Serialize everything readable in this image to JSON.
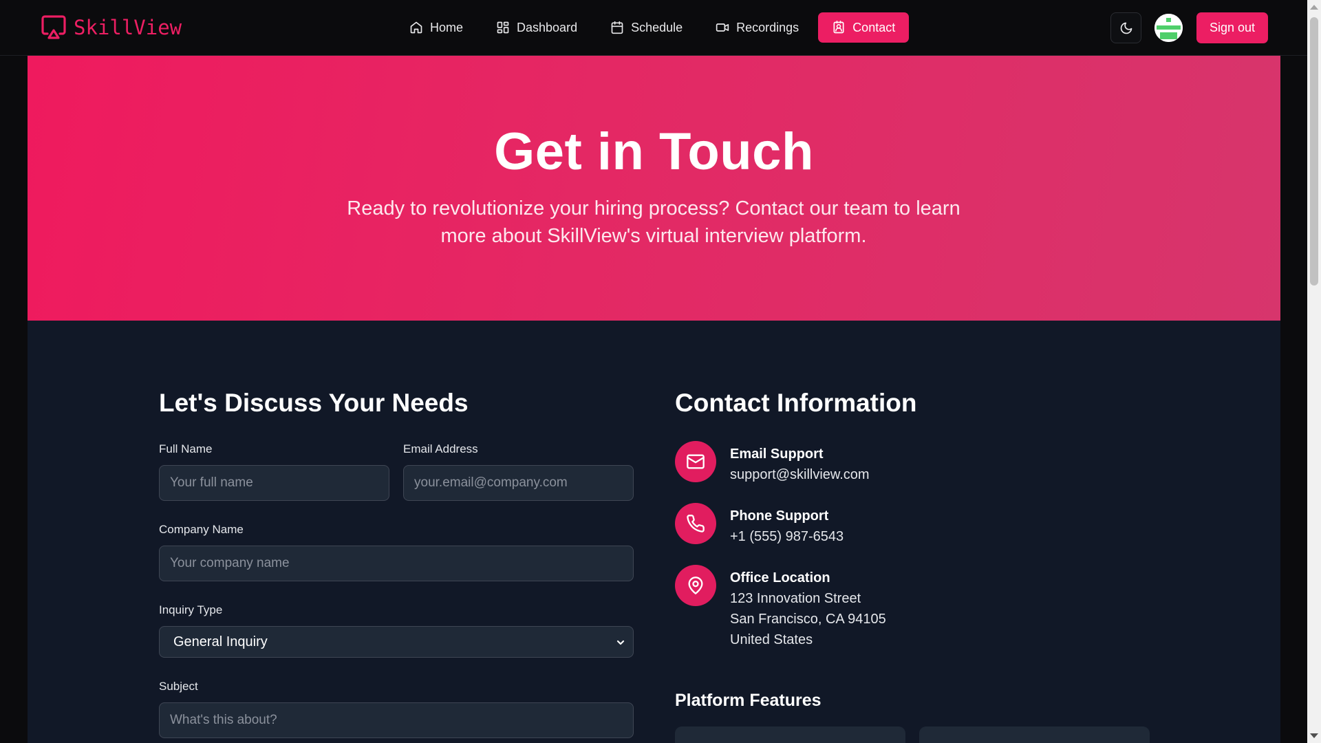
{
  "brand": {
    "name": "SkillView",
    "accent": "#ec1e63"
  },
  "nav": {
    "links": [
      {
        "label": "Home",
        "icon": "home-icon"
      },
      {
        "label": "Dashboard",
        "icon": "dashboard-icon"
      },
      {
        "label": "Schedule",
        "icon": "calendar-icon"
      },
      {
        "label": "Recordings",
        "icon": "video-icon"
      },
      {
        "label": "Contact",
        "icon": "contact-icon",
        "active": true
      }
    ],
    "theme_toggle_icon": "moon-icon",
    "signout_label": "Sign out"
  },
  "hero": {
    "title": "Get in Touch",
    "subtitle": "Ready to revolutionize your hiring process? Contact our team to learn more about SkillView's virtual interview platform."
  },
  "form": {
    "title": "Let's Discuss Your Needs",
    "full_name": {
      "label": "Full Name",
      "placeholder": "Your full name",
      "value": ""
    },
    "email": {
      "label": "Email Address",
      "placeholder": "your.email@company.com",
      "value": ""
    },
    "company": {
      "label": "Company Name",
      "placeholder": "Your company name",
      "value": ""
    },
    "inquiry": {
      "label": "Inquiry Type",
      "selected": "General Inquiry"
    },
    "subject": {
      "label": "Subject",
      "placeholder": "What's this about?",
      "value": ""
    }
  },
  "contact_info": {
    "title": "Contact Information",
    "email": {
      "heading": "Email Support",
      "value": "support@skillview.com",
      "icon": "mail-icon"
    },
    "phone": {
      "heading": "Phone Support",
      "value": "+1 (555) 987-6543",
      "icon": "phone-icon"
    },
    "office": {
      "heading": "Office Location",
      "lines": [
        "123 Innovation Street",
        "San Francisco, CA 94105",
        "United States"
      ],
      "icon": "map-pin-icon"
    }
  },
  "features": {
    "title": "Platform Features"
  },
  "colors": {
    "page_bg": "#0b0b0d",
    "main_bg": "#111827",
    "input_bg": "#1f2937",
    "hero_start": "#ef1a5e",
    "hero_end": "#d7356c"
  }
}
